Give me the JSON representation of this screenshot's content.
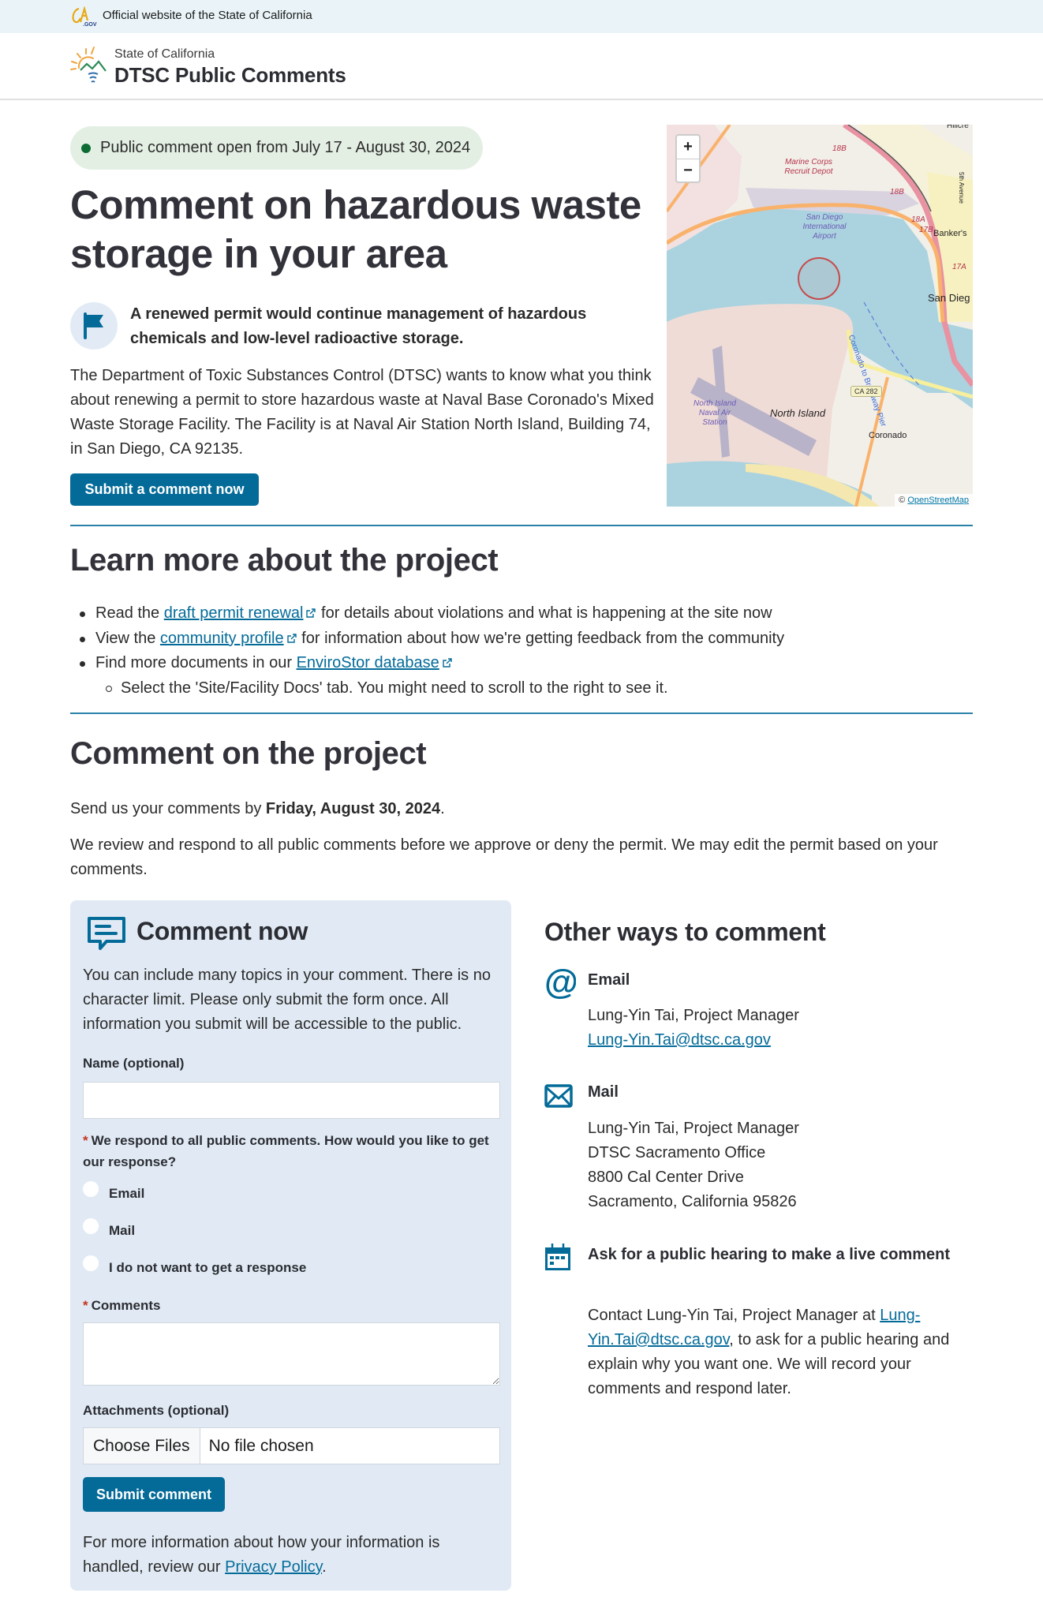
{
  "topbar": {
    "official_text": "Official website of the State of California"
  },
  "header": {
    "state_label": "State of California",
    "site_title": "DTSC Public Comments"
  },
  "hero": {
    "status_pill": "Public comment open from July 17 - August 30, 2024",
    "status_color": "#0b6b33",
    "title": "Comment on hazardous waste storage in your area",
    "lead": "A renewed permit would continue management of hazardous chemicals and low-level radioactive storage.",
    "intro": "The Department of Toxic Substances Control (DTSC) wants to know what you think about renewing a permit to store hazardous waste at Naval Base Coronado's Mixed Waste Storage Facility. The Facility is at Naval Air Station North Island, Building 74, in San Diego, CA 92135.",
    "cta_label": "Submit a comment now"
  },
  "map": {
    "zoom_in": "+",
    "zoom_out": "−",
    "attribution_prefix": "©",
    "attribution_link": "OpenStreetMap",
    "labels": {
      "marine_corps": "Marine Corps Recruit Depot",
      "airport": "San Diego International Airport",
      "bankers": "Banker's",
      "san_diego": "San Dieg",
      "hillcrest": "Hillcre",
      "north_island": "North Island",
      "nas": "North Island Naval Air Station",
      "coronado": "Coronado",
      "ferry": "Coronado to Broadway Pier",
      "ca282": "CA 282",
      "exit_18b_1": "18B",
      "exit_18b_2": "18B",
      "exit_18a": "18A",
      "exit_17b": "17B",
      "exit_17a": "17A",
      "fifth_ave": "5th Avenue"
    }
  },
  "learn_more": {
    "heading": "Learn more about the project",
    "items": [
      {
        "before": "Read the ",
        "link": "draft permit renewal",
        "after": " for details about violations and what is happening at the site now"
      },
      {
        "before": "View the ",
        "link": "community profile",
        "after": " for information about how we're getting feedback from the community"
      },
      {
        "before": "Find more documents in our ",
        "link": "EnviroStor database",
        "after": ""
      }
    ],
    "sub_item": "Select the 'Site/Facility Docs' tab. You might need to scroll to the right to see it."
  },
  "comment_section": {
    "heading": "Comment on the project",
    "deadline_prefix": "Send us your comments by ",
    "deadline_date": "Friday, August 30, 2024",
    "deadline_suffix": ".",
    "review_text": "We review and respond to all public comments before we approve or deny the permit. We may edit the permit based on your comments."
  },
  "form": {
    "title": "Comment now",
    "description": "You can include many topics in your comment. There is no character limit. Please only submit the form once. All information you submit will be accessible to the public.",
    "name_label": "Name (optional)",
    "name_value": "",
    "response_required": "*",
    "response_label": "We respond to all public comments. How would you like to get our response?",
    "response_options": [
      "Email",
      "Mail",
      "I do not want to get a response"
    ],
    "comments_required": "*",
    "comments_label": "Comments",
    "comments_value": "",
    "attachments_label": "Attachments (optional)",
    "choose_files": "Choose Files",
    "no_file": "No file chosen",
    "submit_label": "Submit comment",
    "privacy_prefix": "For more information about how your information is handled, review our ",
    "privacy_link": "Privacy Policy",
    "privacy_suffix": "."
  },
  "other_ways": {
    "heading": "Other ways to comment",
    "email": {
      "title": "Email",
      "contact": "Lung-Yin Tai, Project Manager",
      "address": "Lung-Yin.Tai@dtsc.ca.gov"
    },
    "mail": {
      "title": "Mail",
      "lines": [
        "Lung-Yin Tai, Project Manager",
        "DTSC Sacramento Office",
        "8800 Cal Center Drive",
        "Sacramento, California 95826"
      ]
    },
    "hearing": {
      "title": "Ask for a public hearing to make a live comment",
      "prefix": "Contact Lung-Yin Tai, Project Manager at ",
      "link": "Lung-Yin.Tai@dtsc.ca.gov",
      "suffix": ", to ask for a public hearing and explain why you want one. We will record your comments and respond later."
    }
  },
  "colors": {
    "accent": "#046b99",
    "card_bg": "#e1eaf4",
    "required": "#c6341e"
  }
}
